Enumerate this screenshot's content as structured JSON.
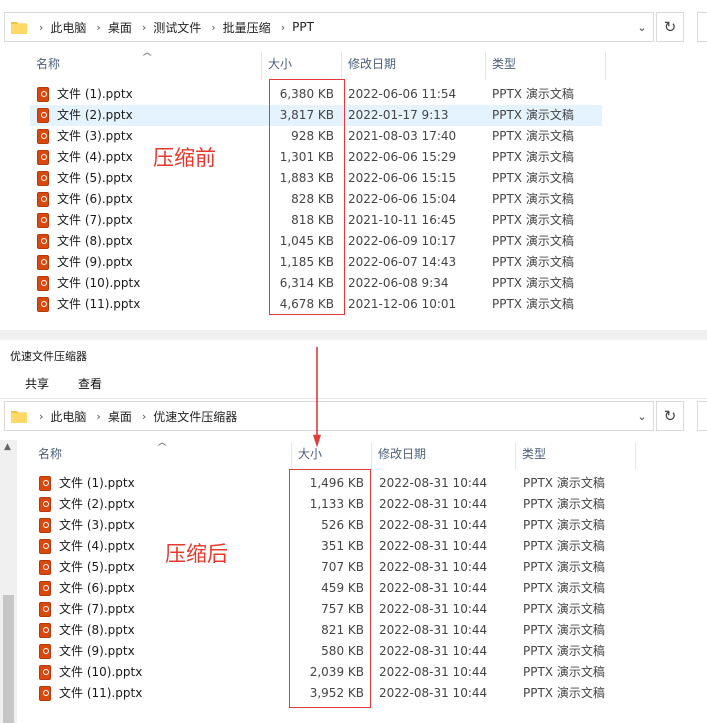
{
  "top_window": {
    "breadcrumb": [
      "此电脑",
      "桌面",
      "测试文件",
      "批量压缩",
      "PPT"
    ],
    "columns": {
      "name": "名称",
      "size": "大小",
      "date": "修改日期",
      "type": "类型"
    },
    "annotation": "压缩前",
    "files": [
      {
        "name": "文件 (1).pptx",
        "size": "6,380 KB",
        "date": "2022-06-06 11:54",
        "type": "PPTX 演示文稿",
        "selected": false
      },
      {
        "name": "文件 (2).pptx",
        "size": "3,817 KB",
        "date": "2022-01-17 9:13",
        "type": "PPTX 演示文稿",
        "selected": true
      },
      {
        "name": "文件 (3).pptx",
        "size": "928 KB",
        "date": "2021-08-03 17:40",
        "type": "PPTX 演示文稿",
        "selected": false
      },
      {
        "name": "文件 (4).pptx",
        "size": "1,301 KB",
        "date": "2022-06-06 15:29",
        "type": "PPTX 演示文稿",
        "selected": false
      },
      {
        "name": "文件 (5).pptx",
        "size": "1,883 KB",
        "date": "2022-06-06 15:15",
        "type": "PPTX 演示文稿",
        "selected": false
      },
      {
        "name": "文件 (6).pptx",
        "size": "828 KB",
        "date": "2022-06-06 15:04",
        "type": "PPTX 演示文稿",
        "selected": false
      },
      {
        "name": "文件 (7).pptx",
        "size": "818 KB",
        "date": "2021-10-11 16:45",
        "type": "PPTX 演示文稿",
        "selected": false
      },
      {
        "name": "文件 (8).pptx",
        "size": "1,045 KB",
        "date": "2022-06-09 10:17",
        "type": "PPTX 演示文稿",
        "selected": false
      },
      {
        "name": "文件 (9).pptx",
        "size": "1,185 KB",
        "date": "2022-06-07 14:43",
        "type": "PPTX 演示文稿",
        "selected": false
      },
      {
        "name": "文件 (10).pptx",
        "size": "6,314 KB",
        "date": "2022-06-08 9:34",
        "type": "PPTX 演示文稿",
        "selected": false
      },
      {
        "name": "文件 (11).pptx",
        "size": "4,678 KB",
        "date": "2021-12-06 10:01",
        "type": "PPTX 演示文稿",
        "selected": false
      }
    ]
  },
  "bottom_window": {
    "title": "优速文件压缩器",
    "ribbon_tabs": [
      "共享",
      "查看"
    ],
    "breadcrumb": [
      "此电脑",
      "桌面",
      "优速文件压缩器"
    ],
    "columns": {
      "name": "名称",
      "size": "大小",
      "date": "修改日期",
      "type": "类型"
    },
    "annotation": "压缩后",
    "files": [
      {
        "name": "文件 (1).pptx",
        "size": "1,496 KB",
        "date": "2022-08-31 10:44",
        "type": "PPTX 演示文稿"
      },
      {
        "name": "文件 (2).pptx",
        "size": "1,133 KB",
        "date": "2022-08-31 10:44",
        "type": "PPTX 演示文稿"
      },
      {
        "name": "文件 (3).pptx",
        "size": "526 KB",
        "date": "2022-08-31 10:44",
        "type": "PPTX 演示文稿"
      },
      {
        "name": "文件 (4).pptx",
        "size": "351 KB",
        "date": "2022-08-31 10:44",
        "type": "PPTX 演示文稿"
      },
      {
        "name": "文件 (5).pptx",
        "size": "707 KB",
        "date": "2022-08-31 10:44",
        "type": "PPTX 演示文稿"
      },
      {
        "name": "文件 (6).pptx",
        "size": "459 KB",
        "date": "2022-08-31 10:44",
        "type": "PPTX 演示文稿"
      },
      {
        "name": "文件 (7).pptx",
        "size": "757 KB",
        "date": "2022-08-31 10:44",
        "type": "PPTX 演示文稿"
      },
      {
        "name": "文件 (8).pptx",
        "size": "821 KB",
        "date": "2022-08-31 10:44",
        "type": "PPTX 演示文稿"
      },
      {
        "name": "文件 (9).pptx",
        "size": "580 KB",
        "date": "2022-08-31 10:44",
        "type": "PPTX 演示文稿"
      },
      {
        "name": "文件 (10).pptx",
        "size": "2,039 KB",
        "date": "2022-08-31 10:44",
        "type": "PPTX 演示文稿"
      },
      {
        "name": "文件 (11).pptx",
        "size": "3,952 KB",
        "date": "2022-08-31 10:44",
        "type": "PPTX 演示文稿"
      }
    ]
  },
  "colors": {
    "annotation_red": "#e8382d",
    "selection": "#e5f3ff",
    "header_text": "#4c607a"
  },
  "icons": [
    "folder-icon",
    "chevron-right-icon",
    "chevron-down-icon",
    "refresh-icon",
    "pptx-file-icon",
    "sort-up-icon",
    "down-arrow-icon"
  ]
}
